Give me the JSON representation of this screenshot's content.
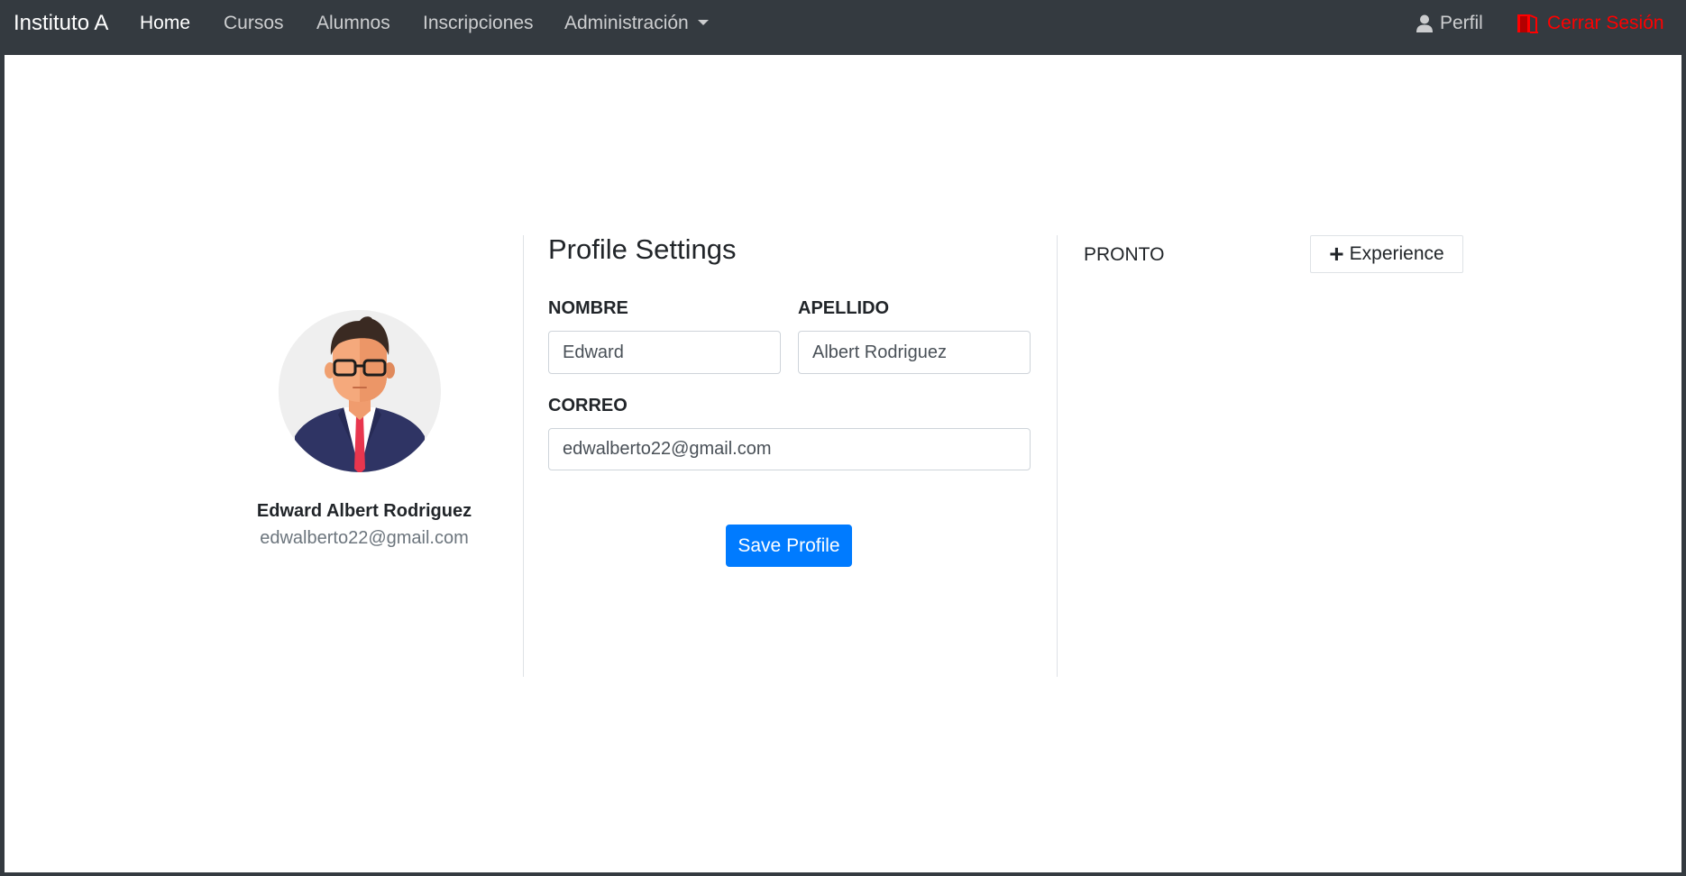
{
  "navbar": {
    "brand": "Instituto A",
    "items": [
      {
        "label": "Home"
      },
      {
        "label": "Cursos"
      },
      {
        "label": "Alumnos"
      },
      {
        "label": "Inscripciones"
      },
      {
        "label": "Administración"
      }
    ],
    "profile_label": "Perfil",
    "logout_label": "Cerrar Sesión"
  },
  "profile": {
    "full_name": "Edward Albert Rodriguez",
    "email": "edwalberto22@gmail.com"
  },
  "settings": {
    "title": "Profile Settings",
    "nombre_label": "NOMBRE",
    "nombre_value": "Edward",
    "apellido_label": "APELLIDO",
    "apellido_value": "Albert Rodriguez",
    "correo_label": "CORREO",
    "correo_value": "edwalberto22@gmail.com",
    "save_label": "Save Profile"
  },
  "experience": {
    "status_text": "PRONTO",
    "button_label": "Experience"
  },
  "colors": {
    "navbar_bg": "#343a40",
    "primary": "#007bff",
    "logout": "#ff0000"
  }
}
